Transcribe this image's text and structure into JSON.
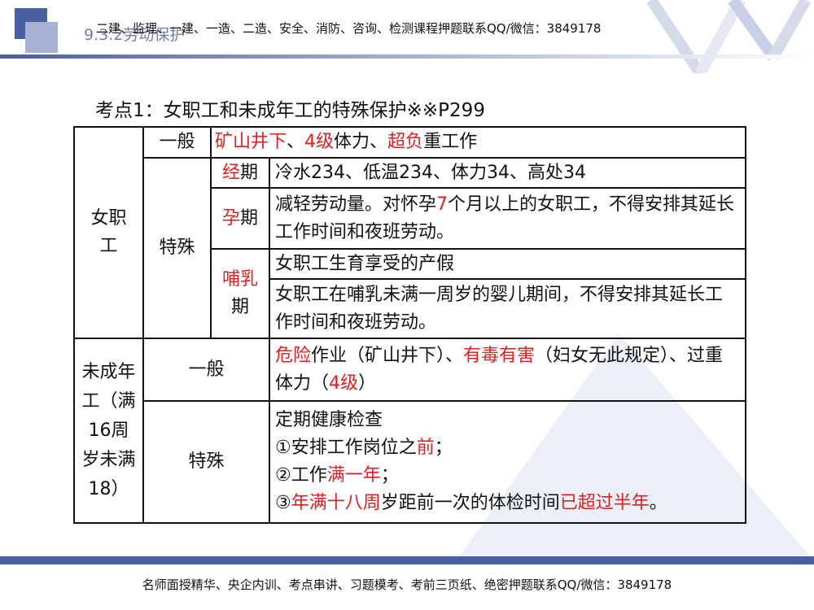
{
  "header": {
    "section": "9.3.2劳动保护",
    "watermark": "二建、监理、一建、一造、二造、安全、消防、咨询、检测课程押题联系QQ/微信：3849178"
  },
  "title": "考点1：女职工和未成年工的特殊保护※※P299",
  "table": {
    "female": {
      "label": "女职工",
      "general": "一般",
      "special": "特殊",
      "general_text": [
        [
          "矿山井下",
          1
        ],
        [
          "、",
          0
        ],
        [
          "4级",
          1
        ],
        [
          "体力、",
          0
        ],
        [
          "超负",
          1
        ],
        [
          "重工作",
          0
        ]
      ],
      "menstrual_label": [
        [
          "经",
          1
        ],
        [
          "期",
          0
        ]
      ],
      "menstrual_text": "冷水234、低温234、体力34、高处34",
      "pregnancy_label": [
        [
          "孕",
          1
        ],
        [
          "期",
          0
        ]
      ],
      "pregnancy_text": [
        [
          "减轻劳动量。对怀孕",
          0
        ],
        [
          "7",
          1
        ],
        [
          "个月以上的女职工，不得安排其延长工作时间和夜班劳动。",
          0
        ]
      ],
      "nursing_label": "哺乳",
      "nursing_label2": "期",
      "nursing_text1": "女职工生育享受的产假",
      "nursing_text2": "女职工在哺乳未满一周岁的婴儿期间，不得安排其延长工作时间和夜班劳动。"
    },
    "minor": {
      "label": "未成年工（满16周岁未满18）",
      "general": "一般",
      "special": "特殊",
      "general_text": [
        [
          "危险",
          1
        ],
        [
          "作业（矿山井下）、",
          0
        ],
        [
          "有毒有害",
          1
        ],
        [
          "（妇女无此规定）、过重体力（",
          0
        ],
        [
          "4级",
          1
        ],
        [
          "）",
          0
        ]
      ],
      "special_lines": [
        [
          [
            "定期健康检查",
            0
          ]
        ],
        [
          [
            "①安排工作岗位之",
            0
          ],
          [
            "前",
            1
          ],
          [
            "；",
            0
          ]
        ],
        [
          [
            "②工作",
            0
          ],
          [
            "满一年",
            1
          ],
          [
            "；",
            0
          ]
        ],
        [
          [
            "③",
            0
          ],
          [
            "年满十八周",
            1
          ],
          [
            "岁距前一次的体检时间",
            0
          ],
          [
            "已超过半年",
            1
          ],
          [
            "。",
            0
          ]
        ]
      ]
    }
  },
  "footer": "名师面授精华、央企内训、考点串讲、习题模考、考前三页纸、绝密押题联系QQ/微信：3849178",
  "colors": {
    "accent": "#4a5fa0",
    "red": "#e02020"
  }
}
